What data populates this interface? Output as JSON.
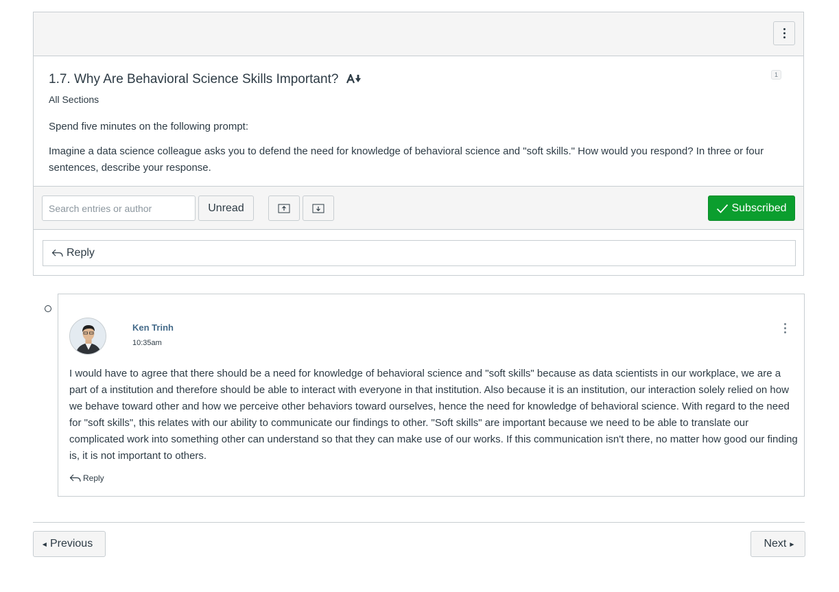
{
  "topic": {
    "title": "1.7. Why Are Behavioral Science Skills Important?",
    "reply_count": "1",
    "sections": "All Sections",
    "prompt_intro": "Spend five minutes on the following prompt:",
    "prompt_body": "Imagine a data science colleague asks you to defend the need for knowledge of behavioral science and \"soft skills.\" How would you respond? In three or four sentences, describe your response."
  },
  "toolbar": {
    "search_placeholder": "Search entries or author",
    "unread_label": "Unread",
    "subscribed_label": "Subscribed",
    "subscribed_color": "#0b9e2e"
  },
  "reply_bar": {
    "label": "Reply"
  },
  "entry": {
    "author": "Ken Trinh",
    "time": "10:35am",
    "body": "I would have to agree that there should be a need for knowledge of behavioral science and \"soft skills\" because as data scientists in our workplace, we are a part of a institution and therefore should be able to interact with everyone in that institution. Also because it is an institution, our interaction solely relied on how we behave toward other and how we perceive other behaviors toward ourselves, hence the need for knowledge of behavioral science. With regard to the need for \"soft skills\", this relates with our ability to communicate our findings to other. \"Soft skills\" are important because we need to be able to translate our complicated work into something other can understand so that they can make use of our works. If this communication isn't there, no matter how good our finding is, it is not important to others.",
    "reply_label": "Reply"
  },
  "footer": {
    "previous_label": "Previous",
    "next_label": "Next"
  },
  "icons": [
    "kebab-menu-icon",
    "text-size-icon",
    "collapse-all-icon",
    "expand-all-icon",
    "checkmark-icon",
    "reply-arrow-icon",
    "user-avatar"
  ]
}
